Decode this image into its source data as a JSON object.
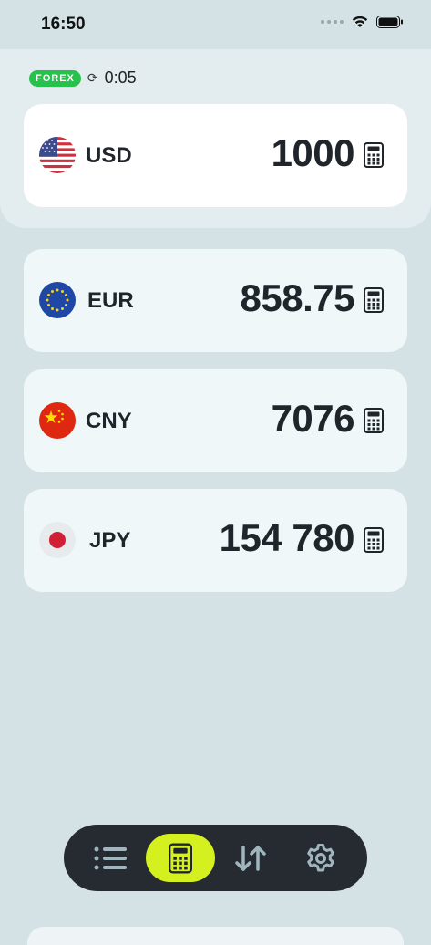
{
  "status": {
    "time": "16:50"
  },
  "meta": {
    "badge": "FOREX",
    "timer": "0:05"
  },
  "base": {
    "code": "USD",
    "amount": "1000",
    "flag": "us-flag-icon"
  },
  "currencies": [
    {
      "code": "EUR",
      "amount": "858.75",
      "flag": "eu-flag-icon"
    },
    {
      "code": "CNY",
      "amount": "7076",
      "flag": "cn-flag-icon"
    },
    {
      "code": "JPY",
      "amount": "154 780",
      "flag": "jp-flag-icon"
    }
  ],
  "tabs": [
    {
      "icon": "list-icon",
      "active": false
    },
    {
      "icon": "calculator-icon",
      "active": true
    },
    {
      "icon": "swap-arrows-icon",
      "active": false
    },
    {
      "icon": "gear-icon",
      "active": false
    }
  ],
  "colors": {
    "background": "#d4e1e5",
    "card": "#f0f7f9",
    "forex_badge": "#27c24c",
    "tab_bar": "#262b31",
    "tab_active": "#d4f01f"
  }
}
